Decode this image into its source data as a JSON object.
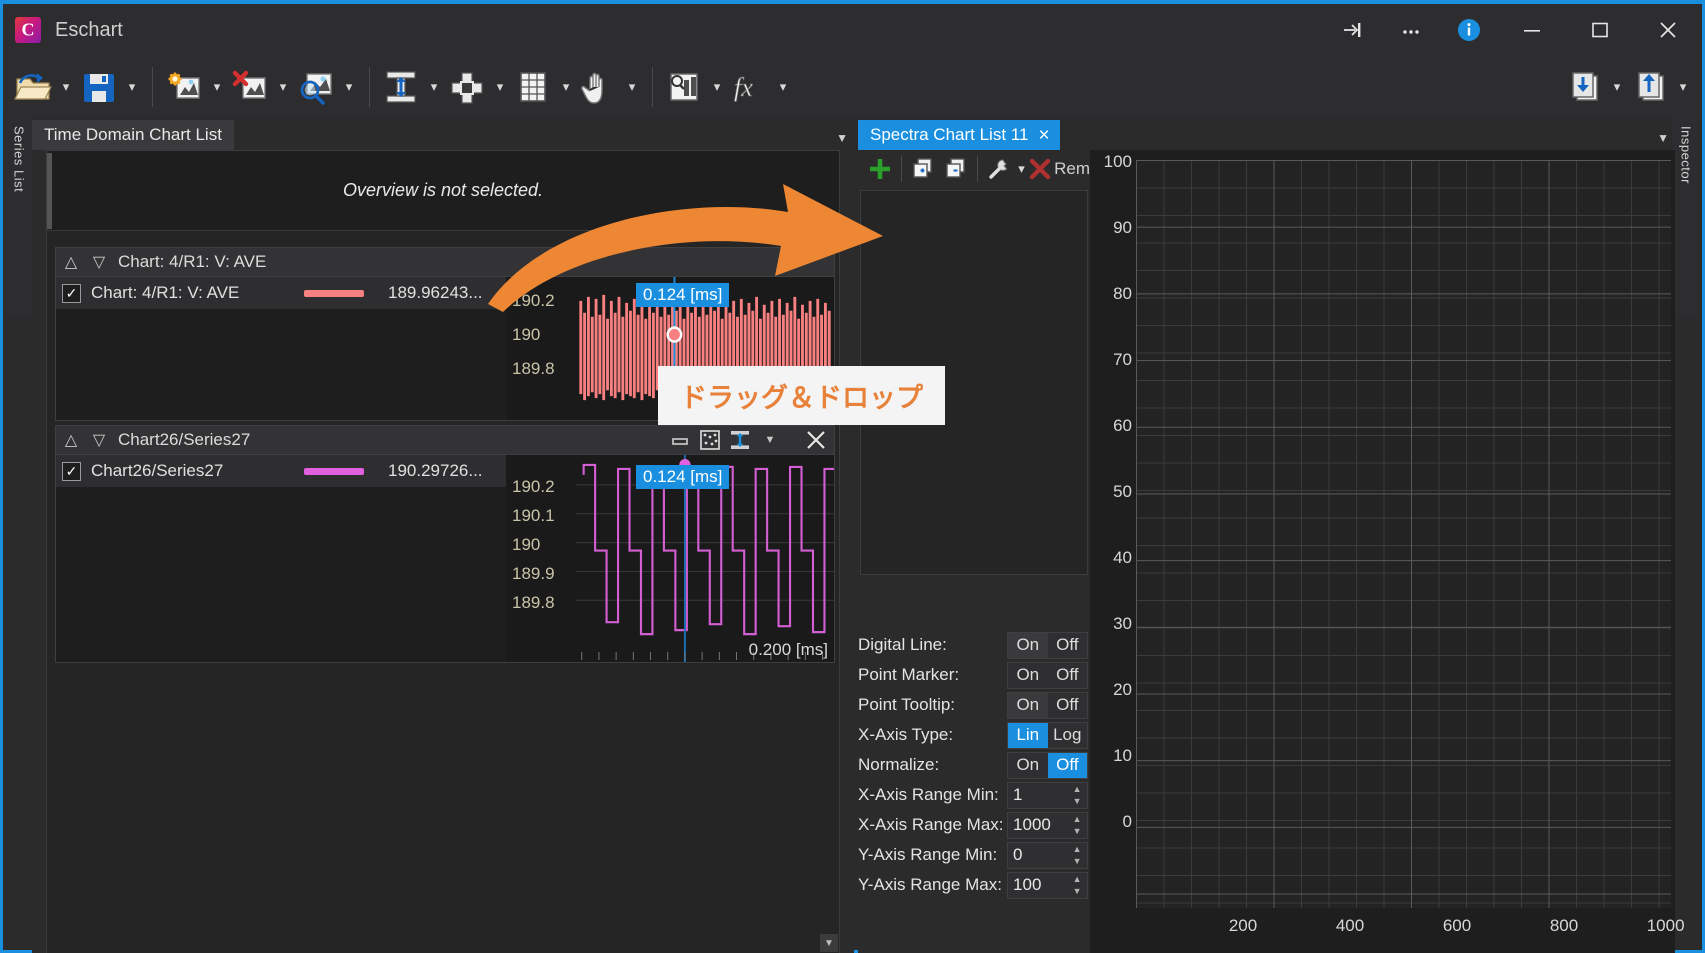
{
  "window": {
    "app_title": "Eschart",
    "logo_letter": "C",
    "buttons": {
      "pin": "pin-icon",
      "more": "...",
      "info": "info-icon",
      "minimize": "minimize-icon",
      "maximize": "maximize-icon",
      "close": "close-icon"
    },
    "accent_color": "#1a8fe0"
  },
  "toolbar": {
    "items": [
      {
        "name": "open-file",
        "icon": "open-folder-icon",
        "has_caret": true
      },
      {
        "name": "save-file",
        "icon": "save-disk-icon",
        "has_caret": true
      },
      {
        "name": "new-chart",
        "icon": "new-chart-icon",
        "has_caret": true
      },
      {
        "name": "delete-chart",
        "icon": "delete-chart-icon",
        "has_caret": true
      },
      {
        "name": "zoom-chart",
        "icon": "zoom-chart-icon",
        "has_caret": true
      },
      {
        "name": "fit-vertical",
        "icon": "fit-vertical-icon",
        "has_caret": true
      },
      {
        "name": "move-cursor",
        "icon": "move-cursor-icon",
        "has_caret": true
      },
      {
        "name": "grid-view",
        "icon": "grid-icon",
        "has_caret": true
      },
      {
        "name": "pan-hand",
        "icon": "hand-icon",
        "has_caret": true
      },
      {
        "name": "statistics",
        "icon": "statistics-icon",
        "has_caret": true
      },
      {
        "name": "function",
        "icon": "fx-icon",
        "has_caret": true
      },
      {
        "name": "import",
        "icon": "import-icon",
        "has_caret": true
      },
      {
        "name": "export",
        "icon": "export-icon",
        "has_caret": true
      }
    ]
  },
  "side_tabs": {
    "left": "Series List",
    "right": "Inspector"
  },
  "left_panel": {
    "tab_label": "Time Domain Chart List",
    "overview_message": "Overview is not selected.",
    "charts": [
      {
        "title": "Chart: 4/R1: V: AVE",
        "series_checked": true,
        "series_name": "Chart: 4/R1: V: AVE",
        "series_color": "#f98080",
        "series_value": "189.96243...",
        "y_ticks": [
          "190.2",
          "190",
          "189.8"
        ],
        "tooltip": "0.124 [ms]",
        "x_label": "",
        "has_header_tools": false
      },
      {
        "title": "Chart26/Series27",
        "series_checked": true,
        "series_name": "Chart26/Series27",
        "series_color": "#e060e0",
        "series_value": "190.29726...",
        "y_ticks": [
          "190.2",
          "190.1",
          "190",
          "189.9",
          "189.8"
        ],
        "tooltip": "0.124 [ms]",
        "x_label": "0.200 [ms]",
        "has_header_tools": true,
        "header_tools": [
          "minimize-icon",
          "fit-all-icon",
          "fit-vertical-icon",
          "chevron-down-icon",
          "close-icon"
        ]
      }
    ]
  },
  "right_panel": {
    "tab_label": "Spectra Chart List 11",
    "tab_close": "×",
    "toolbar": [
      {
        "name": "add-spectra-button",
        "icon": "plus-icon",
        "label": ""
      },
      {
        "name": "copy-add-button",
        "icon": "copy-plus-icon",
        "label": ""
      },
      {
        "name": "copy-remove-button",
        "icon": "copy-minus-icon",
        "label": ""
      },
      {
        "name": "settings-button",
        "icon": "wrench-icon",
        "label": ""
      },
      {
        "name": "remove-button",
        "icon": "red-x-icon",
        "label": "Rem"
      }
    ],
    "options": [
      {
        "label": "Digital Line:",
        "type": "segment",
        "choices": [
          "On",
          "Off"
        ],
        "selected": null,
        "hover": "On"
      },
      {
        "label": "Point Marker:",
        "type": "segment",
        "choices": [
          "On",
          "Off"
        ],
        "selected": null,
        "hover": null
      },
      {
        "label": "Point Tooltip:",
        "type": "segment",
        "choices": [
          "On",
          "Off"
        ],
        "selected": null,
        "hover": "On"
      },
      {
        "label": "X-Axis Type:",
        "type": "segment",
        "choices": [
          "Lin",
          "Log"
        ],
        "selected": "Lin",
        "hover": null
      },
      {
        "label": "Normalize:",
        "type": "segment",
        "choices": [
          "On",
          "Off"
        ],
        "selected": "Off",
        "hover": null
      },
      {
        "label": "X-Axis Range Min:",
        "type": "spinner",
        "value": "1"
      },
      {
        "label": "X-Axis Range Max:",
        "type": "spinner",
        "value": "1000"
      },
      {
        "label": "Y-Axis Range Min:",
        "type": "spinner",
        "value": "0"
      },
      {
        "label": "Y-Axis Range Max:",
        "type": "spinner",
        "value": "100"
      }
    ]
  },
  "chart_data": {
    "type": "line",
    "title": "",
    "xlabel": "",
    "ylabel": "",
    "xlim": [
      1,
      1000
    ],
    "ylim": [
      0,
      100
    ],
    "grid": true,
    "x_ticks": [
      200,
      400,
      600,
      800,
      1000
    ],
    "y_ticks": [
      0,
      10,
      20,
      30,
      40,
      50,
      60,
      70,
      80,
      90,
      100
    ],
    "series": []
  },
  "annotation": {
    "arrow_color": "#ed8733",
    "drag_drop_text": "ドラッグ＆ドロップ",
    "label_bg": "#f4f4f4",
    "label_color": "#e8813a"
  }
}
